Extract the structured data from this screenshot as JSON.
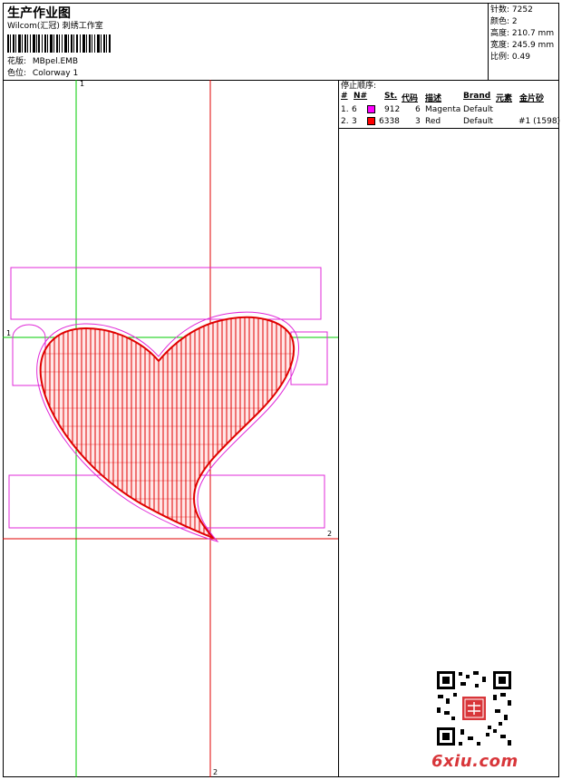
{
  "header": {
    "title": "生产作业图",
    "subtitle": "Wilcom(汇冠) 刺绣工作室",
    "design_label": "花版:",
    "design_value": "MBpel.EMB",
    "colorway_label": "色位:",
    "colorway_value": "Colorway 1"
  },
  "stats": [
    {
      "label": "针数:",
      "value": "7252"
    },
    {
      "label": "颜色:",
      "value": "2"
    },
    {
      "label": "高度:",
      "value": "210.7 mm"
    },
    {
      "label": "宽度:",
      "value": "245.9 mm"
    },
    {
      "label": "比例:",
      "value": "0.49"
    }
  ],
  "stop_sequence": {
    "title": "停止顺序:",
    "columns": {
      "num": "#",
      "needle": "N#",
      "st": "St.",
      "code": "代码",
      "desc": "描述",
      "brand": "Brand",
      "element": "元素",
      "sequin": "金片砂"
    },
    "rows": [
      {
        "num": "1.",
        "needle": "6",
        "color": "#ff00ff",
        "st": "912",
        "code": "6",
        "desc": "Magenta",
        "brand": "Default",
        "element": "",
        "sequin": ""
      },
      {
        "num": "2.",
        "needle": "3",
        "color": "#ff0000",
        "st": "6338",
        "code": "3",
        "desc": "Red",
        "brand": "Default",
        "element": "",
        "sequin": "#1 (1598)"
      }
    ]
  },
  "axis_labels": {
    "green_vertical": "1",
    "green_horizontal": "1",
    "red_horizontal": "2",
    "red_vertical": "2"
  },
  "watermark": {
    "text": "6xiu.com"
  },
  "colors": {
    "magenta": "#ff00ff",
    "red": "#e00000",
    "guide_green": "#00cc00",
    "guide_red": "#e00000",
    "watermark": "#d8363a"
  }
}
